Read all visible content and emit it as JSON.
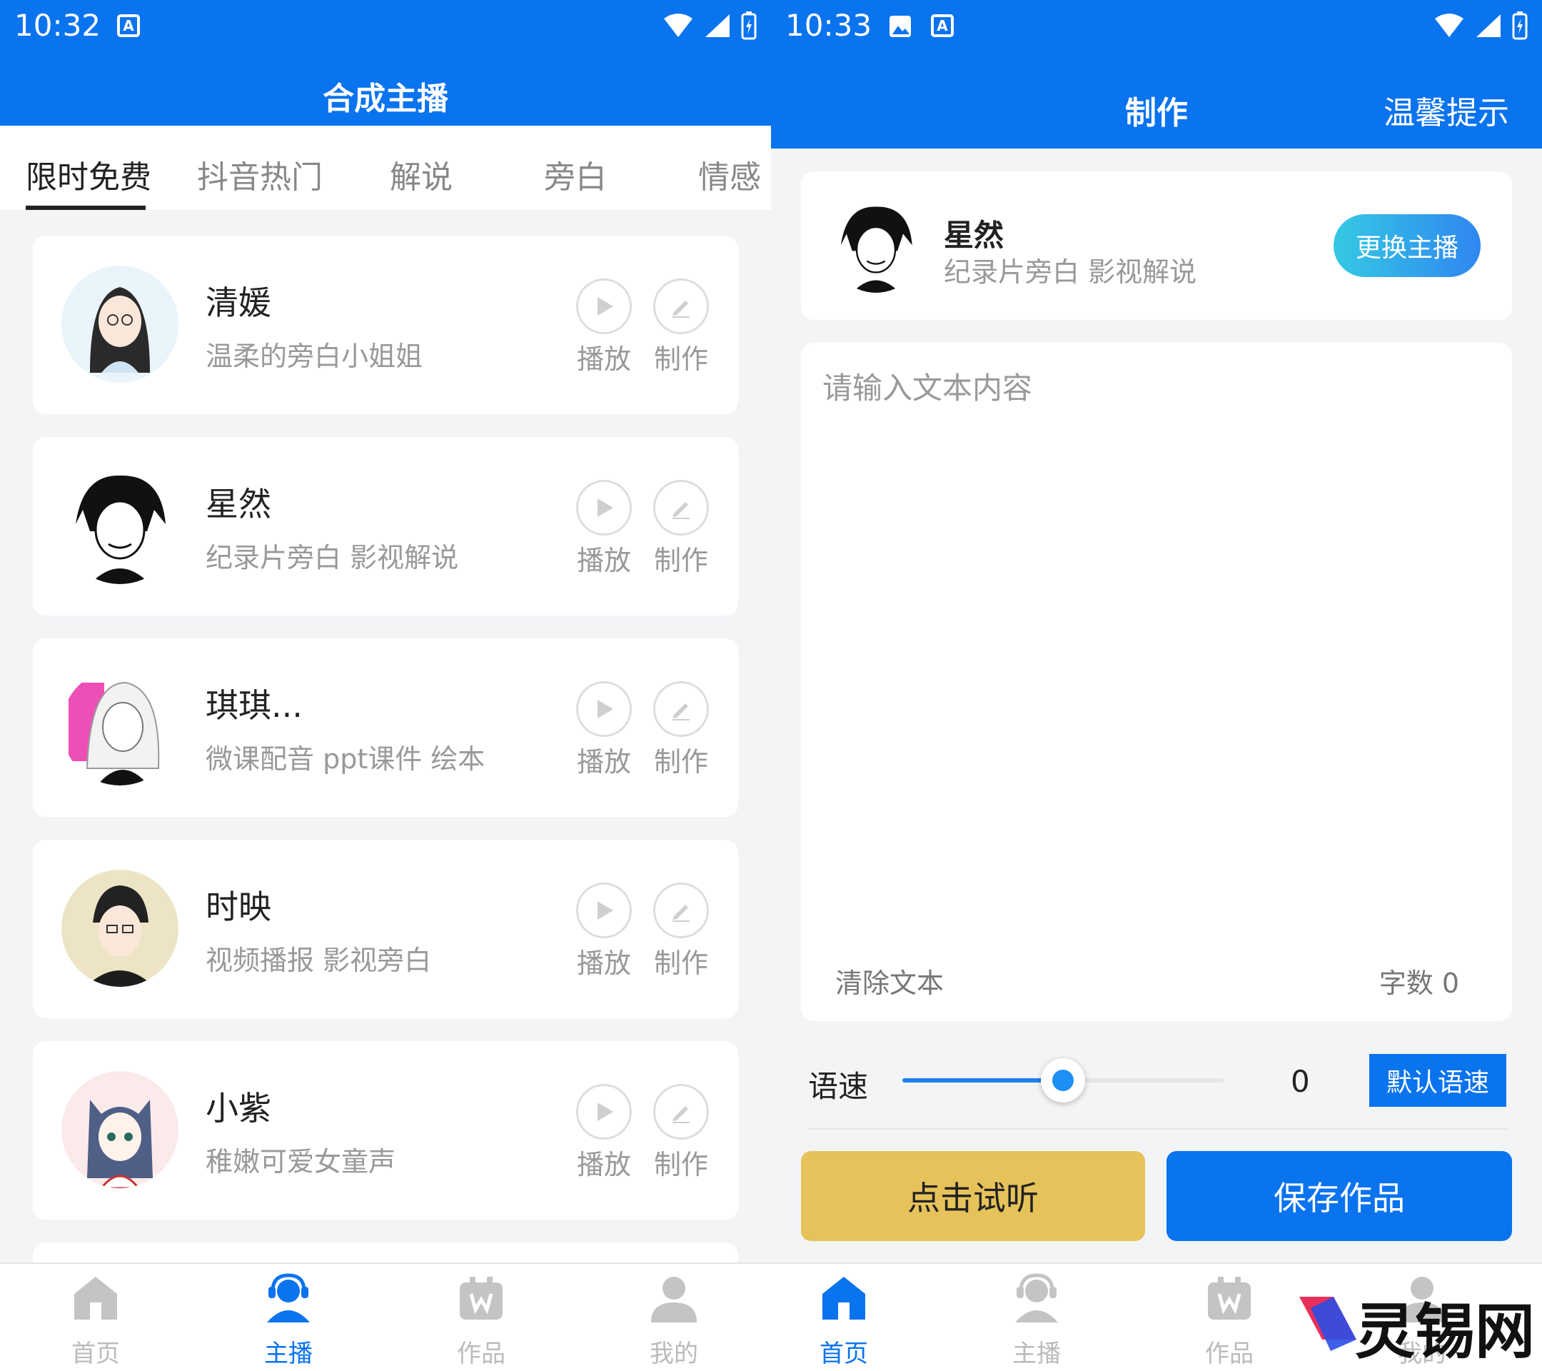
{
  "left": {
    "status": {
      "time": "10:32"
    },
    "title": "合成主播",
    "tabs": [
      {
        "label": "限时免费",
        "active": true
      },
      {
        "label": "抖音热门"
      },
      {
        "label": "解说"
      },
      {
        "label": "旁白"
      },
      {
        "label": "情感"
      }
    ],
    "hosts": [
      {
        "name": "清媛",
        "desc": "温柔的旁白小姐姐",
        "play_label": "播放",
        "make_label": "制作"
      },
      {
        "name": "星然",
        "desc": "纪录片旁白  影视解说",
        "play_label": "播放",
        "make_label": "制作"
      },
      {
        "name": "琪琪...",
        "desc": "微课配音 ppt课件 绘本",
        "play_label": "播放",
        "make_label": "制作"
      },
      {
        "name": "时映",
        "desc": "视频播报   影视旁白",
        "play_label": "播放",
        "make_label": "制作"
      },
      {
        "name": "小紫",
        "desc": "稚嫩可爱女童声",
        "play_label": "播放",
        "make_label": "制作"
      }
    ],
    "nav": [
      {
        "label": "首页",
        "icon": "home-icon"
      },
      {
        "label": "主播",
        "icon": "host-icon",
        "active": true
      },
      {
        "label": "作品",
        "icon": "works-icon"
      },
      {
        "label": "我的",
        "icon": "profile-icon"
      }
    ]
  },
  "right": {
    "status": {
      "time": "10:33"
    },
    "title": "制作",
    "tip": "温馨提示",
    "host": {
      "name": "星然",
      "desc": "纪录片旁白  影视解说"
    },
    "change_host": "更换主播",
    "text_placeholder": "请输入文本内容",
    "clear_text": "清除文本",
    "word_count": "字数 0",
    "speed_label": "语速",
    "speed_level": 0.5,
    "speed_value": "0",
    "default_speed": "默认语速",
    "listen_button": "点击试听",
    "save_button": "保存作品",
    "nav": [
      {
        "label": "首页",
        "icon": "home-icon",
        "active": true
      },
      {
        "label": "主播",
        "icon": "host-icon"
      },
      {
        "label": "作品",
        "icon": "works-icon"
      },
      {
        "label": "我的",
        "icon": "profile-icon"
      }
    ]
  },
  "watermark": "灵锡网",
  "colors": {
    "primary": "#0a73ee",
    "listen": "#e6c25a",
    "inactive": "#bbbbbb"
  }
}
